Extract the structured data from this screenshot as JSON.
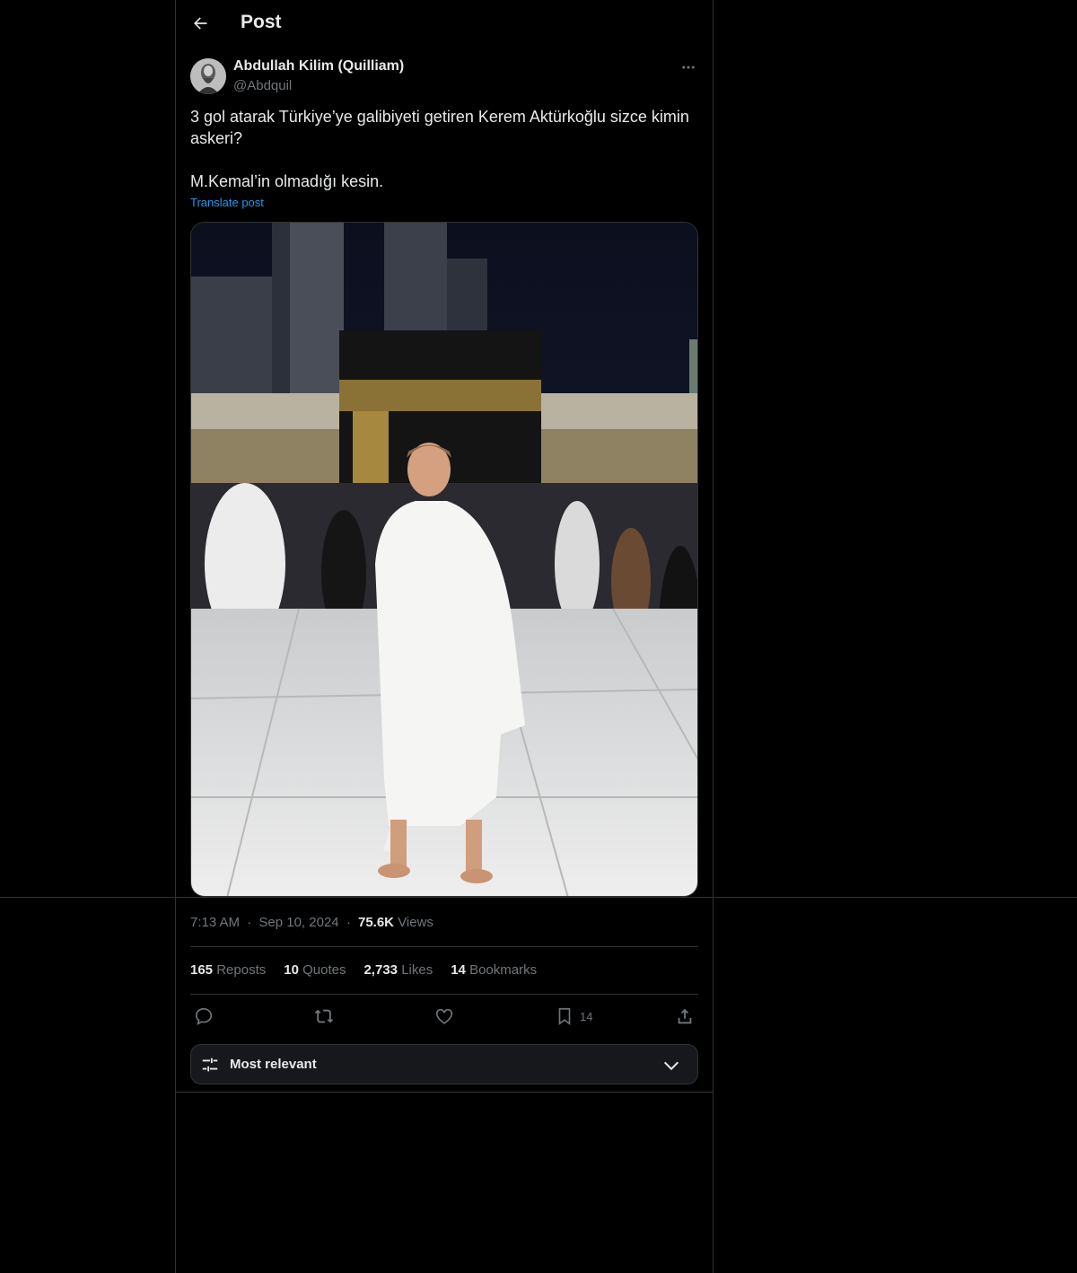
{
  "header": {
    "title": "Post"
  },
  "author": {
    "name": "Abdullah Kilim (Quilliam)",
    "handle": "@Abdquil"
  },
  "post": {
    "paragraphs": [
      "3 gol atarak Türkiye’ye galibiyeti getiren Kerem Aktürkoğlu sizce kimin askeri?",
      "M.Kemal’in olmadığı kesin."
    ],
    "translate_label": "Translate post"
  },
  "meta": {
    "time": "7:13 AM",
    "separator1": "·",
    "date": "Sep 10, 2024",
    "separator2": "·",
    "views_count": "75.6K",
    "views_label": "Views"
  },
  "stats": {
    "reposts_count": "165",
    "reposts_label": "Reposts",
    "quotes_count": "10",
    "quotes_label": "Quotes",
    "likes_count": "2,733",
    "likes_label": "Likes",
    "bookmarks_count": "14",
    "bookmarks_label": "Bookmarks"
  },
  "actions": {
    "bookmark_count": "14"
  },
  "sort": {
    "label": "Most relevant"
  },
  "icons": {
    "back": "arrow-left-icon",
    "more": "more-horizontal-icon",
    "reply": "reply-icon",
    "repost": "repost-icon",
    "like": "heart-icon",
    "bookmark": "bookmark-icon",
    "share": "share-icon",
    "sort": "sliders-icon",
    "chevron": "chevron-down-icon"
  },
  "colors": {
    "background": "#000000",
    "text": "#e7e9ea",
    "muted": "#71767b",
    "link": "#1d9bf0",
    "border": "#2f3336"
  }
}
